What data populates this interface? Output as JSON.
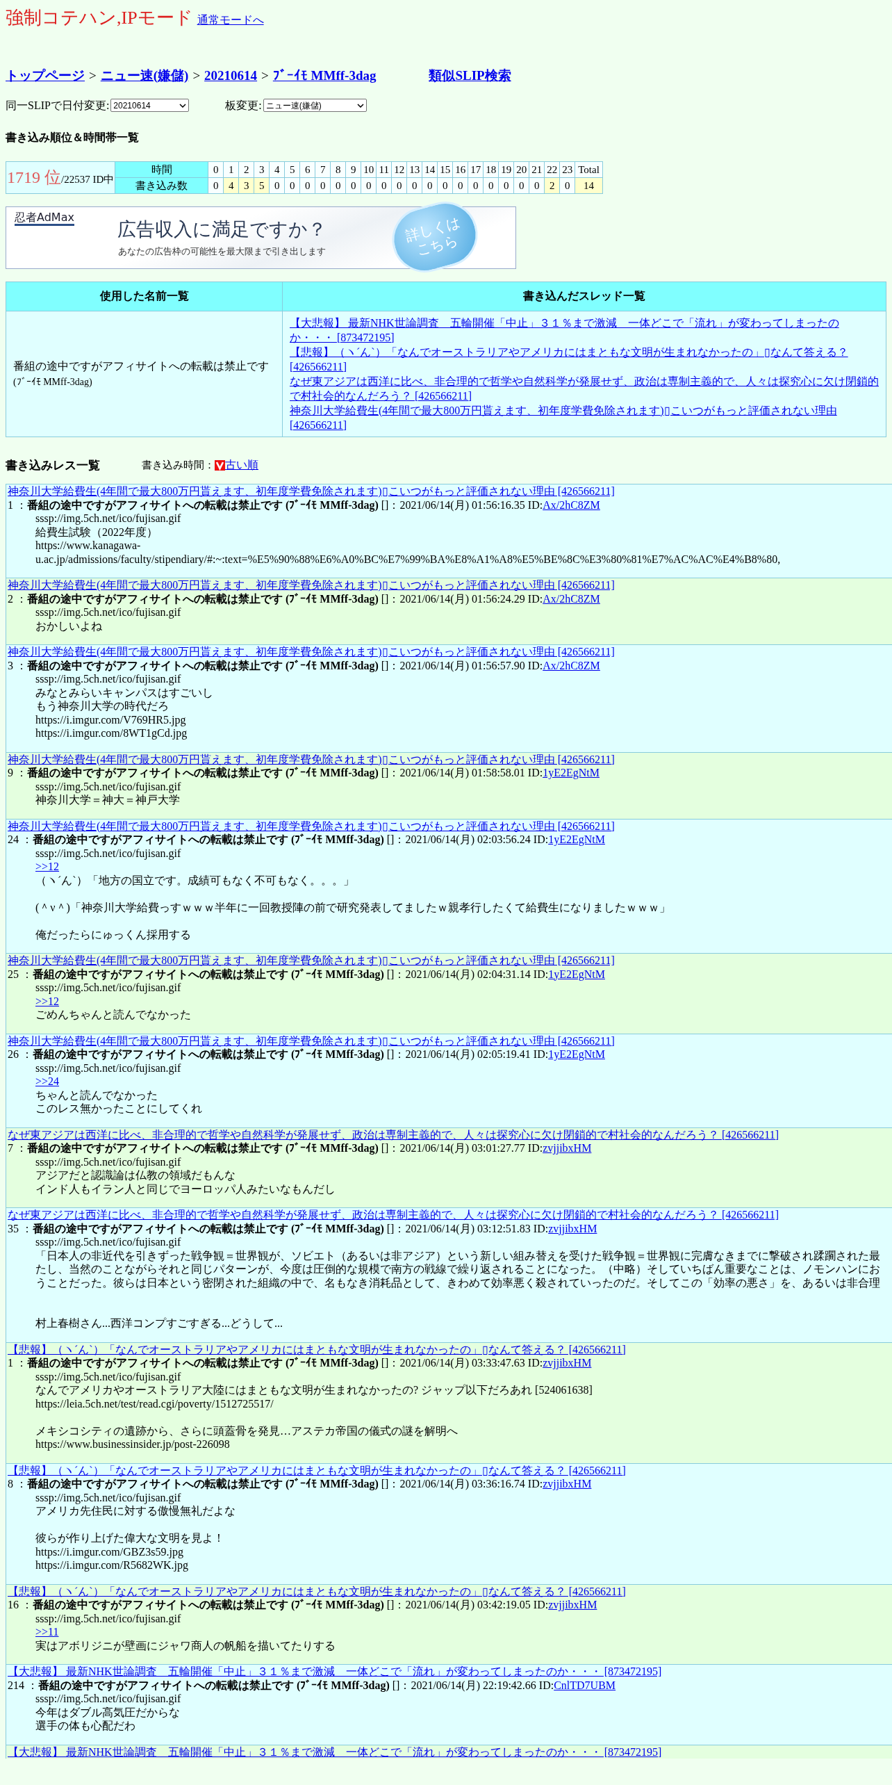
{
  "mode_title": "強制コテハン,IPモード",
  "normal_mode_link": "通常モードへ",
  "breadcrumb": {
    "separator": ">",
    "items": [
      "トップページ",
      "ニュー速(嫌儲)",
      "20210614",
      "ﾌﾞｰｲﾓ MMff-3dag"
    ]
  },
  "similar_slip_link": "類似SLIP検索",
  "date_select": {
    "label": "同一SLIPで日付変更:",
    "value": "20210614"
  },
  "board_select": {
    "label": "板変更:",
    "value": "ニュー速(嫌儲)"
  },
  "ranking_heading": "書き込み順位＆時間帯一覧",
  "ranking": {
    "rank": "1719 位",
    "total": "/22537 ID中",
    "hours_label": "時間",
    "counts_label": "書き込み数",
    "hours": [
      "0",
      "1",
      "2",
      "3",
      "4",
      "5",
      "6",
      "7",
      "8",
      "9",
      "10",
      "11",
      "12",
      "13",
      "14",
      "15",
      "16",
      "17",
      "18",
      "19",
      "20",
      "21",
      "22",
      "23",
      "Total"
    ],
    "counts": [
      {
        "value": "0",
        "highlighted": false
      },
      {
        "value": "4",
        "highlighted": true
      },
      {
        "value": "3",
        "highlighted": true
      },
      {
        "value": "5",
        "highlighted": true
      },
      {
        "value": "0",
        "highlighted": false
      },
      {
        "value": "0",
        "highlighted": false
      },
      {
        "value": "0",
        "highlighted": false
      },
      {
        "value": "0",
        "highlighted": false
      },
      {
        "value": "0",
        "highlighted": false
      },
      {
        "value": "0",
        "highlighted": false
      },
      {
        "value": "0",
        "highlighted": false
      },
      {
        "value": "0",
        "highlighted": false
      },
      {
        "value": "0",
        "highlighted": false
      },
      {
        "value": "0",
        "highlighted": false
      },
      {
        "value": "0",
        "highlighted": false
      },
      {
        "value": "0",
        "highlighted": false
      },
      {
        "value": "0",
        "highlighted": false
      },
      {
        "value": "0",
        "highlighted": false
      },
      {
        "value": "0",
        "highlighted": false
      },
      {
        "value": "0",
        "highlighted": false
      },
      {
        "value": "0",
        "highlighted": false
      },
      {
        "value": "0",
        "highlighted": false
      },
      {
        "value": "2",
        "highlighted": true
      },
      {
        "value": "0",
        "highlighted": false
      },
      {
        "value": "14",
        "highlighted": true
      }
    ]
  },
  "ad_banner": {
    "brand": "忍者AdMax",
    "headline": "広告収入に満足ですか？",
    "subline": "あなたの広告枠の可能性を最大限まで引き出します",
    "button_lines": [
      "詳しくは",
      "こちら"
    ]
  },
  "names_table": {
    "columns": [
      "使用した名前一覧",
      "書き込んだスレッド一覧"
    ],
    "name": "番組の途中ですがアフィサイトへの転載は禁止です",
    "trip": "(ﾌﾞｰｲﾓ MMff-3dag)",
    "threads": [
      "【大悲報】 最新NHK世論調査　五輪開催「中止」３１％まで激減　一体どこで「流れ」が変わってしまったのか・・・ [873472195]",
      "【悲報】（ヽ´ん`）「なんでオーストラリアやアメリカにはまともな文明が生まれなかったの」▯なんて答える？ [426566211]",
      "なぜ東アジアは西洋に比べ、非合理的で哲学や自然科学が発展せず、政治は専制主義的で、人々は探究心に欠け閉鎖的で村社会的なんだろう？ [426566211]",
      "神奈川大学給費生(4年間で最大800万円貰えます、初年度学費免除されます)▯こいつがもっと評価されない理由 [426566211]"
    ]
  },
  "res_heading": "書き込みレス一覧",
  "sort": {
    "label": "書き込み時間：",
    "link": "古い順"
  },
  "posts": [
    {
      "thread": "神奈川大学給費生(4年間で最大800万円貰えます、初年度学費免除されます)▯こいつがもっと評価されない理由 [426566211]",
      "number": "1 ：",
      "name": "番組の途中ですがアフィサイトへの転載は禁止です (ﾌﾞｰｲﾓ MMff-3dag)",
      "meta": " []：2021/06/14(月) 01:56:16.35 ID:",
      "id": "Ax/2hC8ZM",
      "body": [
        {
          "kind": "text",
          "text": "sssp://img.5ch.net/ico/fujisan.gif"
        },
        {
          "kind": "text",
          "text": "給費生試験（2022年度）"
        },
        {
          "kind": "text",
          "text": "https://www.kanagawa-"
        },
        {
          "kind": "text",
          "text": "u.ac.jp/admissions/faculty/stipendiary/#:~:text=%E5%90%88%E6%A0%BC%E7%99%BA%E8%A1%A8%E5%BE%8C%E3%80%81%E7%AC%AC%E4%B8%80,"
        }
      ]
    },
    {
      "thread": "神奈川大学給費生(4年間で最大800万円貰えます、初年度学費免除されます)▯こいつがもっと評価されない理由 [426566211]",
      "number": "2 ：",
      "name": "番組の途中ですがアフィサイトへの転載は禁止です (ﾌﾞｰｲﾓ MMff-3dag)",
      "meta": " []：2021/06/14(月) 01:56:24.29 ID:",
      "id": "Ax/2hC8ZM",
      "body": [
        {
          "kind": "text",
          "text": "sssp://img.5ch.net/ico/fujisan.gif"
        },
        {
          "kind": "text",
          "text": "おかしいよね"
        }
      ]
    },
    {
      "thread": "神奈川大学給費生(4年間で最大800万円貰えます、初年度学費免除されます)▯こいつがもっと評価されない理由 [426566211]",
      "number": "3 ：",
      "name": "番組の途中ですがアフィサイトへの転載は禁止です (ﾌﾞｰｲﾓ MMff-3dag)",
      "meta": " []：2021/06/14(月) 01:56:57.90 ID:",
      "id": "Ax/2hC8ZM",
      "body": [
        {
          "kind": "text",
          "text": "sssp://img.5ch.net/ico/fujisan.gif"
        },
        {
          "kind": "text",
          "text": "みなとみらいキャンパスはすごいし"
        },
        {
          "kind": "text",
          "text": "もう神奈川大学の時代だろ"
        },
        {
          "kind": "text",
          "text": "https://i.imgur.com/V769HR5.jpg"
        },
        {
          "kind": "text",
          "text": "https://i.imgur.com/8WT1gCd.jpg"
        }
      ]
    },
    {
      "thread": "神奈川大学給費生(4年間で最大800万円貰えます、初年度学費免除されます)▯こいつがもっと評価されない理由 [426566211]",
      "number": "9 ：",
      "name": "番組の途中ですがアフィサイトへの転載は禁止です (ﾌﾞｰｲﾓ MMff-3dag)",
      "meta": " []：2021/06/14(月) 01:58:58.01 ID:",
      "id": "1yE2EgNtM",
      "body": [
        {
          "kind": "text",
          "text": "sssp://img.5ch.net/ico/fujisan.gif"
        },
        {
          "kind": "text",
          "text": "神奈川大学＝神大＝神戸大学"
        }
      ]
    },
    {
      "thread": "神奈川大学給費生(4年間で最大800万円貰えます、初年度学費免除されます)▯こいつがもっと評価されない理由 [426566211]",
      "number": "24 ：",
      "name": "番組の途中ですがアフィサイトへの転載は禁止です (ﾌﾞｰｲﾓ MMff-3dag)",
      "meta": " []：2021/06/14(月) 02:03:56.24 ID:",
      "id": "1yE2EgNtM",
      "body": [
        {
          "kind": "text",
          "text": "sssp://img.5ch.net/ico/fujisan.gif"
        },
        {
          "kind": "anchor",
          "text": ">>12"
        },
        {
          "kind": "text",
          "text": "（ヽ´ん`）「地方の国立です。成績可もなく不可もなく。。。」"
        },
        {
          "kind": "blank"
        },
        {
          "kind": "text",
          "text": "(＾ν＾)「神奈川大学給費っすｗｗｗ半年に一回教授陣の前で研究発表してましたｗ親孝行したくて給費生になりましたｗｗｗ」"
        },
        {
          "kind": "blank"
        },
        {
          "kind": "text",
          "text": "俺だったらにゅっくん採用する"
        }
      ]
    },
    {
      "thread": "神奈川大学給費生(4年間で最大800万円貰えます、初年度学費免除されます)▯こいつがもっと評価されない理由 [426566211]",
      "number": "25 ：",
      "name": "番組の途中ですがアフィサイトへの転載は禁止です (ﾌﾞｰｲﾓ MMff-3dag)",
      "meta": " []：2021/06/14(月) 02:04:31.14 ID:",
      "id": "1yE2EgNtM",
      "body": [
        {
          "kind": "text",
          "text": "sssp://img.5ch.net/ico/fujisan.gif"
        },
        {
          "kind": "anchor",
          "text": ">>12"
        },
        {
          "kind": "text",
          "text": "ごめんちゃんと読んでなかった"
        }
      ]
    },
    {
      "thread": "神奈川大学給費生(4年間で最大800万円貰えます、初年度学費免除されます)▯こいつがもっと評価されない理由 [426566211]",
      "number": "26 ：",
      "name": "番組の途中ですがアフィサイトへの転載は禁止です (ﾌﾞｰｲﾓ MMff-3dag)",
      "meta": " []：2021/06/14(月) 02:05:19.41 ID:",
      "id": "1yE2EgNtM",
      "body": [
        {
          "kind": "text",
          "text": "sssp://img.5ch.net/ico/fujisan.gif"
        },
        {
          "kind": "anchor",
          "text": ">>24"
        },
        {
          "kind": "text",
          "text": "ちゃんと読んでなかった"
        },
        {
          "kind": "text",
          "text": "このレス無かったことにしてくれ"
        }
      ]
    },
    {
      "thread": "なぜ東アジアは西洋に比べ、非合理的で哲学や自然科学が発展せず、政治は専制主義的で、人々は探究心に欠け閉鎖的で村社会的なんだろう？ [426566211]",
      "number": "7 ：",
      "name": "番組の途中ですがアフィサイトへの転載は禁止です (ﾌﾞｰｲﾓ MMff-3dag)",
      "meta": " []：2021/06/14(月) 03:01:27.77 ID:",
      "id": "zvjjibxHM",
      "body": [
        {
          "kind": "text",
          "text": "sssp://img.5ch.net/ico/fujisan.gif"
        },
        {
          "kind": "text",
          "text": "アジアだと認識論は仏教の領域だもんな"
        },
        {
          "kind": "text",
          "text": "インド人もイラン人と同じでヨーロッパ人みたいなもんだし"
        }
      ]
    },
    {
      "thread": "なぜ東アジアは西洋に比べ、非合理的で哲学や自然科学が発展せず、政治は専制主義的で、人々は探究心に欠け閉鎖的で村社会的なんだろう？ [426566211]",
      "number": "35 ：",
      "name": "番組の途中ですがアフィサイトへの転載は禁止です (ﾌﾞｰｲﾓ MMff-3dag)",
      "meta": " []：2021/06/14(月) 03:12:51.83 ID:",
      "id": "zvjjibxHM",
      "body": [
        {
          "kind": "text",
          "text": "sssp://img.5ch.net/ico/fujisan.gif"
        },
        {
          "kind": "text",
          "text": "「日本人の非近代を引きずった戦争観＝世界観が、ソビエト（あるいは非アジア）という新しい組み替えを受けた戦争観＝世界観に完膚なきまでに撃破され蹂躙された最"
        },
        {
          "kind": "text",
          "text": "たし、当然のことながらそれと同じパターンが、今度は圧倒的な規模で南方の戦線で繰り返されることになった。（中略）そしていちばん重要なことは、ノモンハンにお"
        },
        {
          "kind": "text",
          "text": "うことだった。彼らは日本という密閉された組織の中で、名もなき消耗品として、きわめて効率悪く殺されていったのだ。そしてこの「効率の悪さ」を、あるいは非合理"
        },
        {
          "kind": "blank"
        },
        {
          "kind": "blank"
        },
        {
          "kind": "text",
          "text": "村上春樹さん...西洋コンプすごすぎる...どうして..."
        }
      ]
    },
    {
      "thread": "【悲報】（ヽ´ん`）「なんでオーストラリアやアメリカにはまともな文明が生まれなかったの」▯なんて答える？ [426566211]",
      "number": "1 ：",
      "name": "番組の途中ですがアフィサイトへの転載は禁止です (ﾌﾞｰｲﾓ MMff-3dag)",
      "meta": " []：2021/06/14(月) 03:33:47.63 ID:",
      "id": "zvjjibxHM",
      "body": [
        {
          "kind": "text",
          "text": "sssp://img.5ch.net/ico/fujisan.gif"
        },
        {
          "kind": "text",
          "text": "なんでアメリカやオーストラリア大陸にはまともな文明が生まれなかったの? ジャップ以下だろあれ [524061638]"
        },
        {
          "kind": "text",
          "text": "https://leia.5ch.net/test/read.cgi/poverty/1512725517/"
        },
        {
          "kind": "blank"
        },
        {
          "kind": "text",
          "text": "メキシコシティの遺跡から、さらに頭蓋骨を発見…アステカ帝国の儀式の謎を解明へ"
        },
        {
          "kind": "text",
          "text": "https://www.businessinsider.jp/post-226098"
        }
      ]
    },
    {
      "thread": "【悲報】（ヽ´ん`）「なんでオーストラリアやアメリカにはまともな文明が生まれなかったの」▯なんて答える？ [426566211]",
      "number": "8 ：",
      "name": "番組の途中ですがアフィサイトへの転載は禁止です (ﾌﾞｰｲﾓ MMff-3dag)",
      "meta": " []：2021/06/14(月) 03:36:16.74 ID:",
      "id": "zvjjibxHM",
      "body": [
        {
          "kind": "text",
          "text": "sssp://img.5ch.net/ico/fujisan.gif"
        },
        {
          "kind": "text",
          "text": "アメリカ先住民に対する傲慢無礼だよな"
        },
        {
          "kind": "blank"
        },
        {
          "kind": "text",
          "text": "彼らが作り上げた偉大な文明を見よ！"
        },
        {
          "kind": "text",
          "text": "https://i.imgur.com/GBZ3s59.jpg"
        },
        {
          "kind": "text",
          "text": "https://i.imgur.com/R5682WK.jpg"
        }
      ]
    },
    {
      "thread": "【悲報】（ヽ´ん`）「なんでオーストラリアやアメリカにはまともな文明が生まれなかったの」▯なんて答える？ [426566211]",
      "number": "16 ：",
      "name": "番組の途中ですがアフィサイトへの転載は禁止です (ﾌﾞｰｲﾓ MMff-3dag)",
      "meta": " []：2021/06/14(月) 03:42:19.05 ID:",
      "id": "zvjjibxHM",
      "body": [
        {
          "kind": "text",
          "text": "sssp://img.5ch.net/ico/fujisan.gif"
        },
        {
          "kind": "anchor",
          "text": ">>11"
        },
        {
          "kind": "text",
          "text": "実はアボリジニが壁画にジャワ商人の帆船を描いてたりする"
        }
      ]
    },
    {
      "thread": "【大悲報】 最新NHK世論調査　五輪開催「中止」３１％まで激減　一体どこで「流れ」が変わってしまったのか・・・ [873472195]",
      "number": "214 ：",
      "name": "番組の途中ですがアフィサイトへの転載は禁止です (ﾌﾞｰｲﾓ MMff-3dag)",
      "meta": " []：2021/06/14(月) 22:19:42.66 ID:",
      "id": "CnlTD7UBM",
      "body": [
        {
          "kind": "text",
          "text": "sssp://img.5ch.net/ico/fujisan.gif"
        },
        {
          "kind": "text",
          "text": "今年はダブル高気圧だからな"
        },
        {
          "kind": "text",
          "text": "選手の体も心配だわ"
        }
      ]
    },
    {
      "thread": "【大悲報】 最新NHK世論調査　五輪開催「中止」３１％まで激減　一体どこで「流れ」が変わってしまったのか・・・ [873472195]"
    }
  ]
}
